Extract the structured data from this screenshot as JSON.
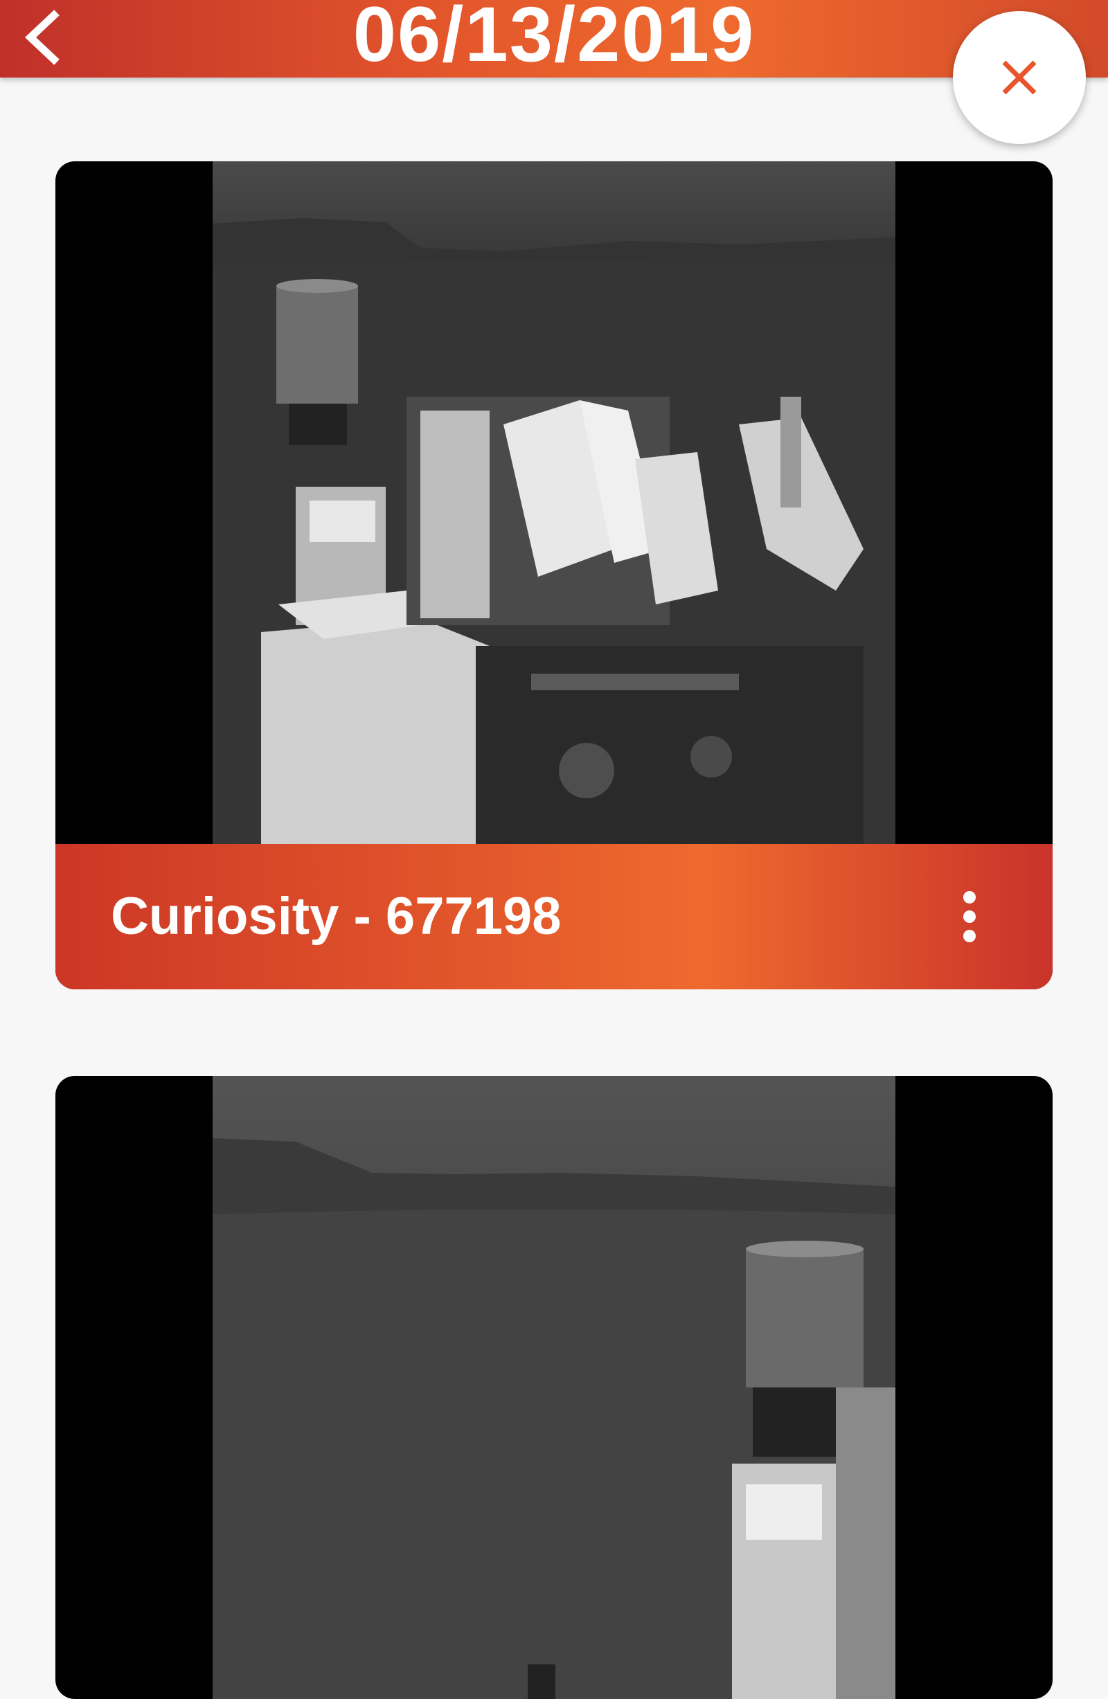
{
  "header": {
    "title": "06/13/2019",
    "back_icon": "chevron-left-icon",
    "close_icon": "close-icon"
  },
  "photos": [
    {
      "title": "Curiosity - 677198",
      "menu_icon": "more-vert-icon"
    },
    {
      "title": ""
    }
  ],
  "colors": {
    "header_start": "#c0302a",
    "header_mid": "#ee6a2e",
    "accent_close": "#e8552c",
    "background": "#f7f7f7"
  }
}
